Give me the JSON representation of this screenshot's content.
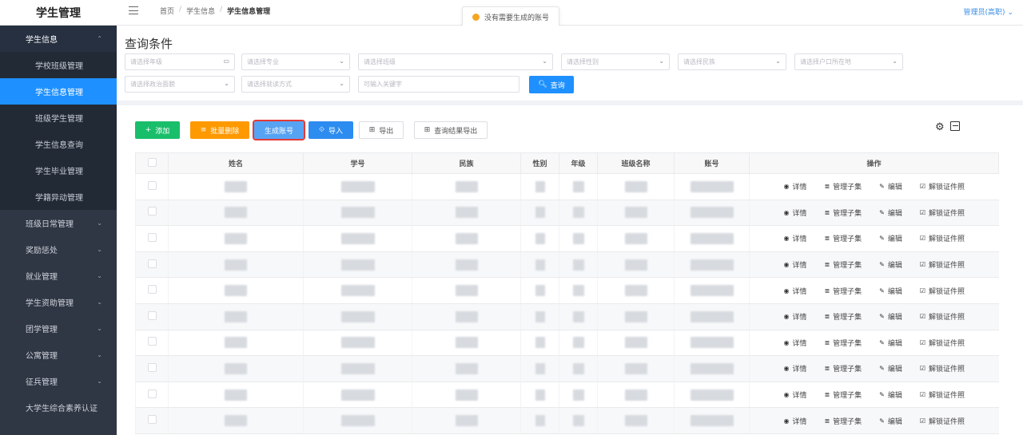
{
  "header": {
    "brand": "学生管理",
    "breadcrumb": [
      "首页",
      "学生信息",
      "学生信息管理"
    ],
    "toast": "没有需要生成的账号",
    "user": "管理员(高职)"
  },
  "sidebar": {
    "groups": [
      {
        "label": "学生信息",
        "open": true,
        "items": [
          "学校班级管理",
          "学生信息管理",
          "班级学生管理",
          "学生信息查询",
          "学生毕业管理",
          "学籍异动管理"
        ],
        "active": "学生信息管理"
      },
      {
        "label": "班级日常管理"
      },
      {
        "label": "奖励惩处"
      },
      {
        "label": "就业管理"
      },
      {
        "label": "学生资助管理"
      },
      {
        "label": "团学管理"
      },
      {
        "label": "公寓管理"
      },
      {
        "label": "征兵管理"
      },
      {
        "label": "大学生综合素养认证"
      }
    ]
  },
  "filters": {
    "title": "查询条件",
    "row1": [
      "请选择年级",
      "请选择专业",
      "请选择班级",
      "请选择性别",
      "请选择民族",
      "请选择户口所在地"
    ],
    "row2": [
      "请选择政治面貌",
      "请选择就读方式"
    ],
    "keyword_placeholder": "可输入关键字",
    "search_label": "查询"
  },
  "toolbar": {
    "add": "添加",
    "batch_delete": "批量删除",
    "generate_account": "生成账号",
    "import": "导入",
    "export": "导出",
    "export_results": "查询结果导出"
  },
  "table": {
    "columns": [
      "",
      "姓名",
      "学号",
      "民族",
      "性别",
      "年级",
      "班级名称",
      "账号",
      "操作"
    ],
    "row_count": 10,
    "actions": [
      "详情",
      "管理子集",
      "编辑",
      "解锁证件照"
    ]
  },
  "colors": {
    "sidebar_bg": "#2f3644",
    "active_item": "#1e90ff",
    "add": "#19be6b",
    "batch_delete": "#ff9900",
    "generate_account": "#57a3f3",
    "import": "#2d8cf0",
    "highlight_outline": "#e53935"
  }
}
